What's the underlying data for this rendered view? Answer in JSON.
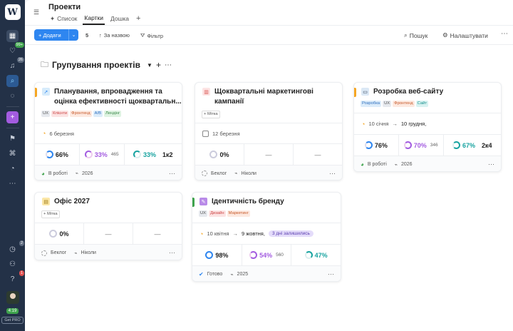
{
  "app": {
    "logo": "W"
  },
  "sidebar": {
    "badges": {
      "notif": "99+",
      "bell": "26",
      "clock": "2",
      "help": "1"
    },
    "time": "4:19",
    "getpro": "Get PRO"
  },
  "header": {
    "title": "Проекти",
    "tabs": [
      {
        "label": "Список"
      },
      {
        "label": "Картки"
      },
      {
        "label": "Дошка"
      }
    ],
    "add_tab": "+"
  },
  "toolbar": {
    "add_label": "Додати",
    "count": "5",
    "sort_label": "За назвою",
    "filter_label": "Фільтр",
    "search_label": "Пошук",
    "settings_label": "Налаштувати"
  },
  "group": {
    "title": "Групування проектів"
  },
  "cards": [
    {
      "title": "Планування, впровадження та оцінка ефективності щоквартальн...",
      "tags": [
        "UX",
        "Клієнти",
        "Фронтенд",
        "A/B",
        "Лендінг"
      ],
      "date": "6 березня",
      "stats": [
        {
          "value": "66%"
        },
        {
          "value": "33%",
          "sub": "465"
        },
        {
          "value": "33%"
        },
        {
          "value": "1к2"
        }
      ],
      "status": "В роботі",
      "year": "2026"
    },
    {
      "title": "Щоквартальні маркетингові кампанії",
      "tag": "Мітка",
      "date": "12 березня",
      "stats": [
        {
          "value": "0%"
        },
        {
          "value": "—"
        },
        {
          "value": "—"
        }
      ],
      "status": "Беклог",
      "year": "Ніколи"
    },
    {
      "title": "Розробка веб-сайту",
      "tags": [
        "Розробка",
        "UX",
        "Фронтенд",
        "Сайт"
      ],
      "date_from": "10 січня",
      "date_to": "10 грудня,",
      "stats": [
        {
          "value": "76%"
        },
        {
          "value": "70%",
          "sub": "346"
        },
        {
          "value": "67%"
        },
        {
          "value": "2к4"
        }
      ],
      "status": "В роботі",
      "year": "2026"
    },
    {
      "title": "Офіс 2027",
      "tag": "Мітка",
      "stats": [
        {
          "value": "0%"
        },
        {
          "value": "—"
        },
        {
          "value": "—"
        }
      ],
      "status": "Беклог",
      "year": "Ніколи"
    },
    {
      "title": "Ідентичність бренду",
      "tags": [
        "UX",
        "Дизайн",
        "Маркетинг"
      ],
      "date_from": "10 квітня",
      "date_to": "9 жовтня,",
      "days_left": "3 дні залишились",
      "stats": [
        {
          "value": "98%"
        },
        {
          "value": "54%",
          "sub": "560"
        },
        {
          "value": "47%"
        }
      ],
      "status": "Готово",
      "year": "2025"
    }
  ],
  "colors": {
    "accent": "#2e86f0",
    "sidebar": "#233147",
    "orange": "#f5a623",
    "green": "#3fa34d",
    "purple": "#a35ce0",
    "teal": "#18a3a0"
  }
}
